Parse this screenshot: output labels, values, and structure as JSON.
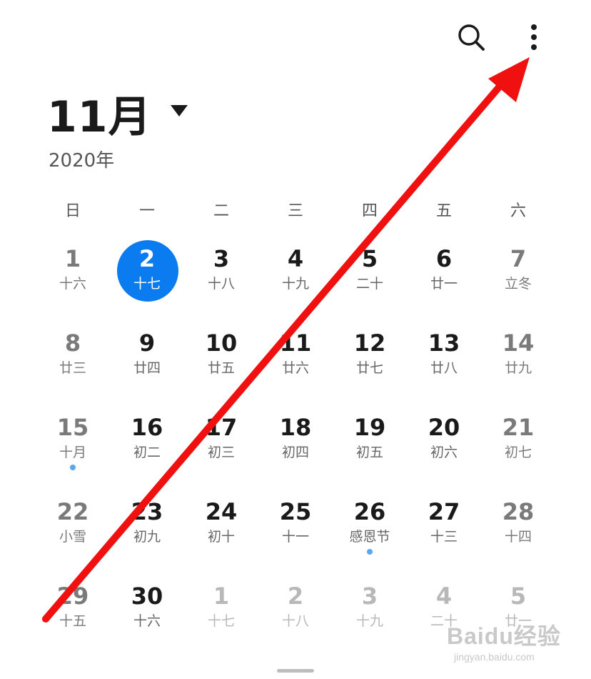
{
  "header": {
    "month": "11月",
    "year": "2020年"
  },
  "weekdays": [
    "日",
    "一",
    "二",
    "三",
    "四",
    "五",
    "六"
  ],
  "days": [
    {
      "n": "1",
      "l": "十六",
      "w": true,
      "o": false,
      "t": false,
      "e": false
    },
    {
      "n": "2",
      "l": "十七",
      "w": false,
      "o": false,
      "t": true,
      "e": false
    },
    {
      "n": "3",
      "l": "十八",
      "w": false,
      "o": false,
      "t": false,
      "e": false
    },
    {
      "n": "4",
      "l": "十九",
      "w": false,
      "o": false,
      "t": false,
      "e": false
    },
    {
      "n": "5",
      "l": "二十",
      "w": false,
      "o": false,
      "t": false,
      "e": false
    },
    {
      "n": "6",
      "l": "廿一",
      "w": false,
      "o": false,
      "t": false,
      "e": false
    },
    {
      "n": "7",
      "l": "立冬",
      "w": true,
      "o": false,
      "t": false,
      "e": false
    },
    {
      "n": "8",
      "l": "廿三",
      "w": true,
      "o": false,
      "t": false,
      "e": false
    },
    {
      "n": "9",
      "l": "廿四",
      "w": false,
      "o": false,
      "t": false,
      "e": false
    },
    {
      "n": "10",
      "l": "廿五",
      "w": false,
      "o": false,
      "t": false,
      "e": false
    },
    {
      "n": "11",
      "l": "廿六",
      "w": false,
      "o": false,
      "t": false,
      "e": false
    },
    {
      "n": "12",
      "l": "廿七",
      "w": false,
      "o": false,
      "t": false,
      "e": false
    },
    {
      "n": "13",
      "l": "廿八",
      "w": false,
      "o": false,
      "t": false,
      "e": false
    },
    {
      "n": "14",
      "l": "廿九",
      "w": true,
      "o": false,
      "t": false,
      "e": false
    },
    {
      "n": "15",
      "l": "十月",
      "w": true,
      "o": false,
      "t": false,
      "e": true
    },
    {
      "n": "16",
      "l": "初二",
      "w": false,
      "o": false,
      "t": false,
      "e": false
    },
    {
      "n": "17",
      "l": "初三",
      "w": false,
      "o": false,
      "t": false,
      "e": false
    },
    {
      "n": "18",
      "l": "初四",
      "w": false,
      "o": false,
      "t": false,
      "e": false
    },
    {
      "n": "19",
      "l": "初五",
      "w": false,
      "o": false,
      "t": false,
      "e": false
    },
    {
      "n": "20",
      "l": "初六",
      "w": false,
      "o": false,
      "t": false,
      "e": false
    },
    {
      "n": "21",
      "l": "初七",
      "w": true,
      "o": false,
      "t": false,
      "e": false
    },
    {
      "n": "22",
      "l": "小雪",
      "w": true,
      "o": false,
      "t": false,
      "e": false
    },
    {
      "n": "23",
      "l": "初九",
      "w": false,
      "o": false,
      "t": false,
      "e": false
    },
    {
      "n": "24",
      "l": "初十",
      "w": false,
      "o": false,
      "t": false,
      "e": false
    },
    {
      "n": "25",
      "l": "十一",
      "w": false,
      "o": false,
      "t": false,
      "e": false
    },
    {
      "n": "26",
      "l": "感恩节",
      "w": false,
      "o": false,
      "t": false,
      "e": true
    },
    {
      "n": "27",
      "l": "十三",
      "w": false,
      "o": false,
      "t": false,
      "e": false
    },
    {
      "n": "28",
      "l": "十四",
      "w": true,
      "o": false,
      "t": false,
      "e": false
    },
    {
      "n": "29",
      "l": "十五",
      "w": true,
      "o": false,
      "t": false,
      "e": false
    },
    {
      "n": "30",
      "l": "十六",
      "w": false,
      "o": false,
      "t": false,
      "e": false
    },
    {
      "n": "1",
      "l": "十七",
      "w": false,
      "o": true,
      "t": false,
      "e": false
    },
    {
      "n": "2",
      "l": "十八",
      "w": false,
      "o": true,
      "t": false,
      "e": false
    },
    {
      "n": "3",
      "l": "十九",
      "w": false,
      "o": true,
      "t": false,
      "e": false
    },
    {
      "n": "4",
      "l": "二十",
      "w": false,
      "o": true,
      "t": false,
      "e": false
    },
    {
      "n": "5",
      "l": "廿一",
      "w": false,
      "o": true,
      "t": false,
      "e": false
    }
  ],
  "icons": {
    "search": "search-icon",
    "more": "more-vertical-icon",
    "dropdown": "caret-down-icon"
  },
  "colors": {
    "today_bg": "#0a7cf0",
    "event_dot": "#5aa6f5",
    "annotation_arrow": "#f01010"
  },
  "watermark": {
    "brand": "Baidu经验",
    "site": "jingyan.baidu.com"
  }
}
